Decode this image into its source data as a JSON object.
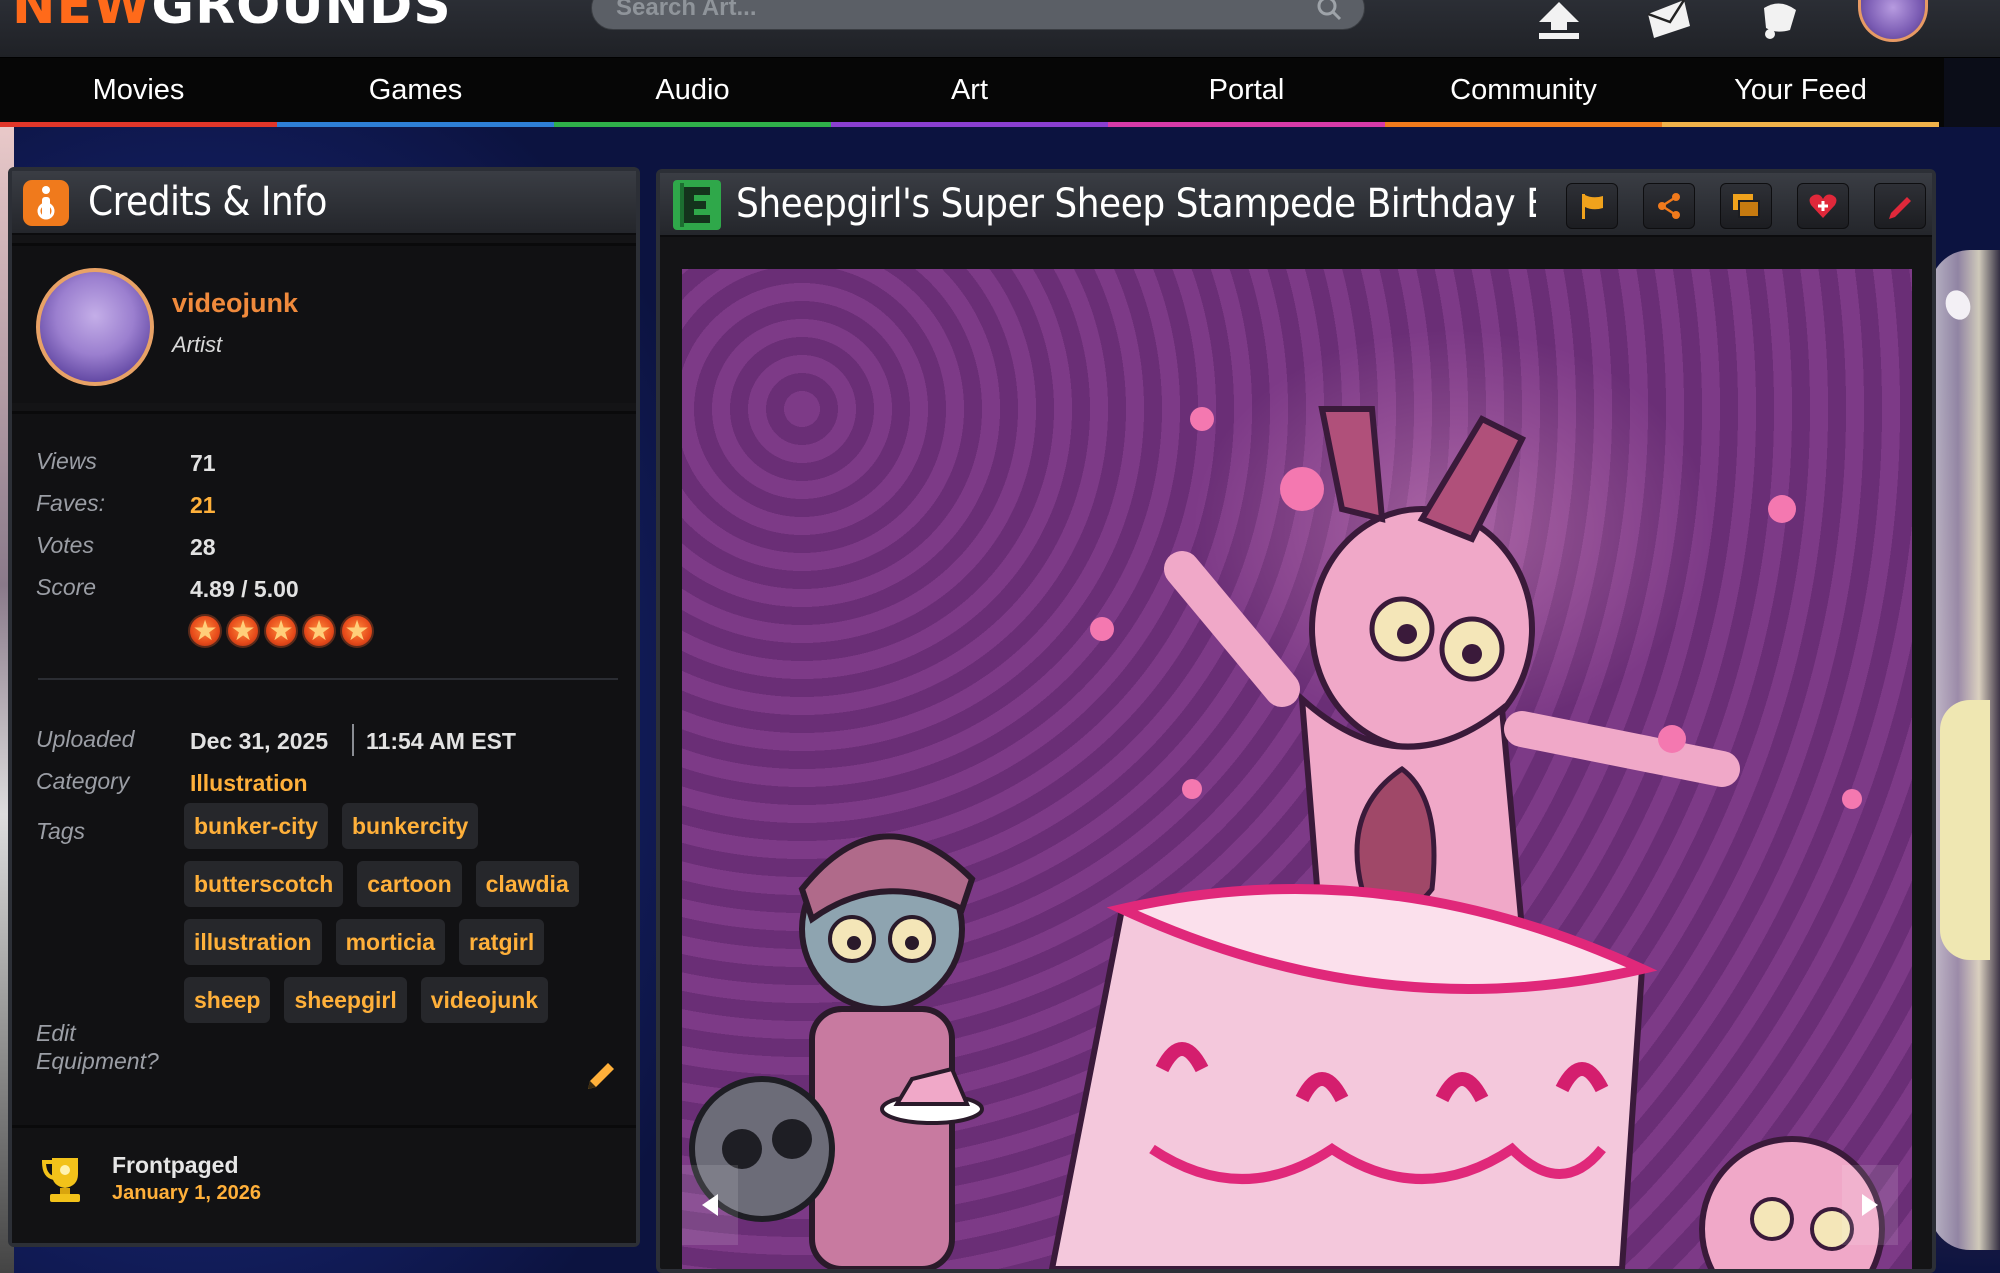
{
  "header": {
    "logo_new": "NEW",
    "logo_grounds": "GROUNDS",
    "search_placeholder": "Search Art..."
  },
  "nav": {
    "items": [
      {
        "label": "Movies",
        "color": "#e0362a"
      },
      {
        "label": "Games",
        "color": "#2e7fd6"
      },
      {
        "label": "Audio",
        "color": "#2fb04a"
      },
      {
        "label": "Art",
        "color": "#8a3fd1"
      },
      {
        "label": "Portal",
        "color": "#d63aa8"
      },
      {
        "label": "Community",
        "color": "#f07a1c"
      },
      {
        "label": "Your Feed",
        "color": "#f0b24a"
      }
    ]
  },
  "credits": {
    "title": "Credits & Info",
    "author": {
      "name": "videojunk",
      "role": "Artist"
    },
    "stats": {
      "views_label": "Views",
      "views": "71",
      "faves_label": "Faves:",
      "faves": "21",
      "votes_label": "Votes",
      "votes": "28",
      "score_label": "Score",
      "score": "4.89 / 5.00",
      "stars": 5
    },
    "details": {
      "uploaded_label": "Uploaded",
      "uploaded_date": "Dec 31, 2025",
      "uploaded_time": "11:54 AM EST",
      "category_label": "Category",
      "category": "Illustration",
      "tags_label": "Tags",
      "tags": [
        "bunker-city",
        "bunkercity",
        "butterscotch",
        "cartoon",
        "clawdia",
        "illustration",
        "morticia",
        "ratgirl",
        "sheep",
        "sheepgirl",
        "videojunk"
      ],
      "edit_equipment_line1": "Edit",
      "edit_equipment_line2": "Equipment?"
    },
    "frontpage": {
      "title": "Frontpaged",
      "date": "January 1, 2026"
    }
  },
  "art_panel": {
    "title": "Sheepgirl's Super Sheep Stampede Birthday B..."
  },
  "colors": {
    "accent_orange": "#ffb03a",
    "author_orange": "#f08a3c"
  }
}
